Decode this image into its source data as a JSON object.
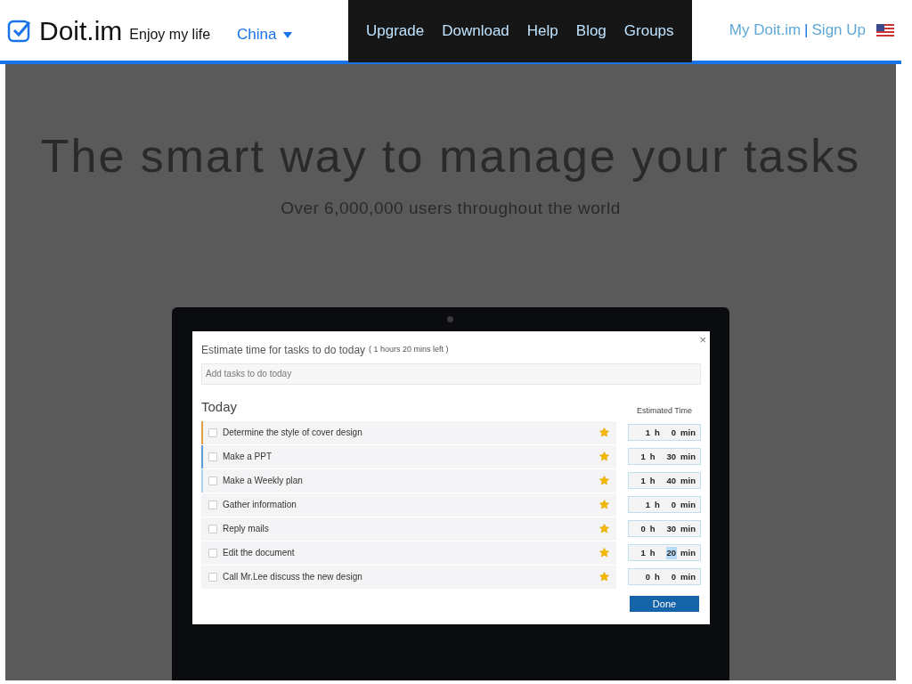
{
  "header": {
    "brand": "Doit.im",
    "tagline": "Enjoy my life",
    "region": "China",
    "nav": [
      "Upgrade",
      "Download",
      "Help",
      "Blog",
      "Groups"
    ],
    "account_links": [
      "My Doit.im",
      "|",
      "Sign Up"
    ]
  },
  "hero": {
    "headline": "The smart way to manage your tasks",
    "subheadline": "Over 6,000,000 users throughout the world"
  },
  "dialog": {
    "title": "Estimate time for tasks to do today",
    "time_left": "( 1 hours 20 mins left )",
    "close": "×",
    "add_task": {
      "placeholder": "Add tasks to do today"
    },
    "section": "Today",
    "column_heading": "Estimated Time",
    "tasks": [
      {
        "name": "Determine the style of cover design",
        "checked": false,
        "starred": true,
        "color": "#e0a040",
        "hours": "1",
        "hours_unit": "h",
        "minutes": "0",
        "minutes_unit": "min",
        "minutes_selected": false
      },
      {
        "name": "Make a PPT",
        "checked": false,
        "starred": true,
        "color": "#5b9bd5",
        "hours": "1",
        "hours_unit": "h",
        "minutes": "30",
        "minutes_unit": "min",
        "minutes_selected": false
      },
      {
        "name": "Make a Weekly plan",
        "checked": false,
        "starred": true,
        "color": "#a9d3f0",
        "hours": "1",
        "hours_unit": "h",
        "minutes": "40",
        "minutes_unit": "min",
        "minutes_selected": false
      },
      {
        "name": "Gather information",
        "checked": false,
        "starred": true,
        "hours": "1",
        "hours_unit": "h",
        "minutes": "0",
        "minutes_unit": "min",
        "minutes_selected": false
      },
      {
        "name": "Reply mails",
        "checked": false,
        "starred": true,
        "hours": "0",
        "hours_unit": "h",
        "minutes": "30",
        "minutes_unit": "min",
        "minutes_selected": false
      },
      {
        "name": "Edit the document",
        "checked": false,
        "starred": true,
        "hours": "1",
        "hours_unit": "h",
        "minutes": "20",
        "minutes_unit": "min",
        "minutes_selected": true
      },
      {
        "name": "Call Mr.Lee discuss the new design",
        "checked": false,
        "starred": true,
        "hours": "0",
        "hours_unit": "h",
        "minutes": "0",
        "minutes_unit": "min",
        "minutes_selected": false
      }
    ],
    "done_button": "Done"
  }
}
